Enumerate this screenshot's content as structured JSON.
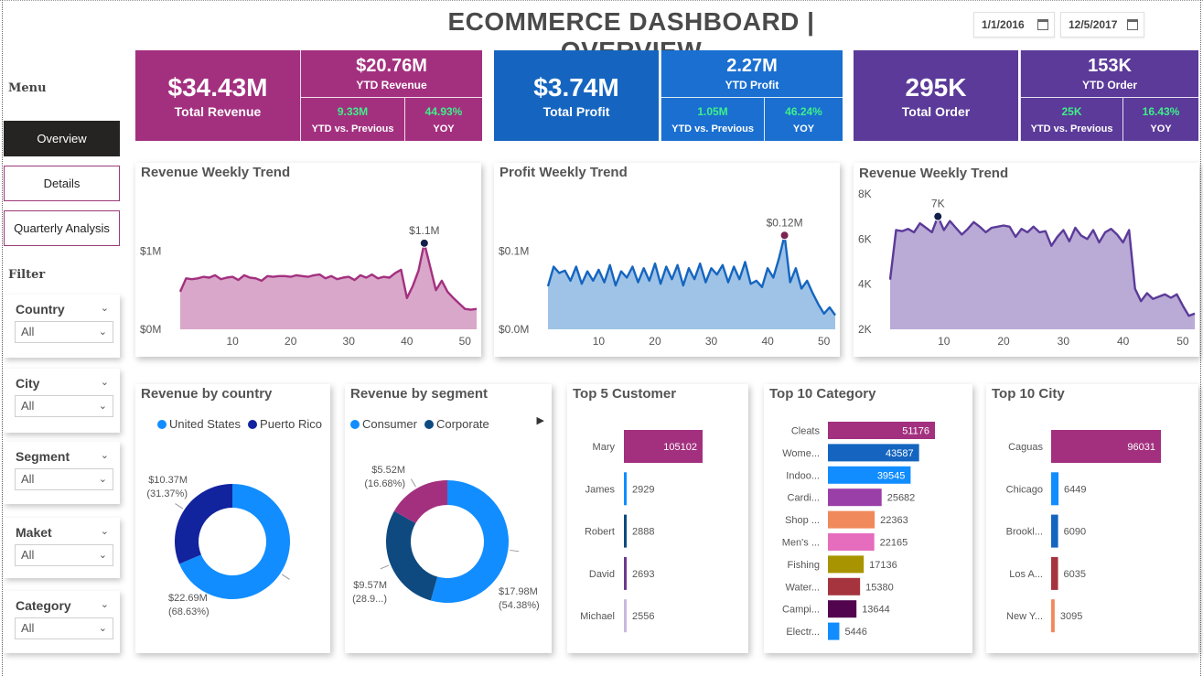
{
  "title": "ECOMMERCE DASHBOARD | OVERVIEW",
  "dates": {
    "start": "1/1/2016",
    "end": "12/5/2017"
  },
  "sidebar": {
    "menu_heading": "Menu",
    "menu_items": [
      "Overview",
      "Details",
      "Quarterly Analysis"
    ],
    "filter_heading": "Filter",
    "filters": [
      {
        "label": "Country",
        "value": "All"
      },
      {
        "label": "City",
        "value": "All"
      },
      {
        "label": "Segment",
        "value": "All"
      },
      {
        "label": "Maket",
        "value": "All"
      },
      {
        "label": "Category",
        "value": "All"
      }
    ]
  },
  "kpis": [
    {
      "value": "$34.43M",
      "label": "Total Revenue",
      "ytd_value": "$20.76M",
      "ytd_label": "YTD Revenue",
      "vs_value": "9.33M",
      "vs_label": "YTD vs. Previous",
      "yoy_value": "44.93%",
      "yoy_label": "YOY",
      "color_main": "#a3307f",
      "color_side": "#a3307f"
    },
    {
      "value": "$3.74M",
      "label": "Total Profit",
      "ytd_value": "2.27M",
      "ytd_label": "YTD Profit",
      "vs_value": "1.05M",
      "vs_label": "YTD vs. Previous",
      "yoy_value": "46.24%",
      "yoy_label": "YOY",
      "color_main": "#1565c0",
      "color_side": "#1a6fd1"
    },
    {
      "value": "295K",
      "label": "Total Order",
      "ytd_value": "153K",
      "ytd_label": "YTD Order",
      "vs_value": "25K",
      "vs_label": "YTD vs. Previous",
      "yoy_value": "16.43%",
      "yoy_label": "YOY",
      "color_main": "#5b3a99",
      "color_side": "#5b3a99"
    }
  ],
  "chart_data": [
    {
      "type": "area",
      "title": "Revenue Weekly Trend",
      "x_ticks": [
        10,
        20,
        30,
        40,
        50
      ],
      "y_ticks": [
        "$0M",
        "$1M"
      ],
      "ylim": [
        0,
        1.6
      ],
      "peak_label": "$1.1M",
      "color": "#a3307f",
      "fill": "#d9a7c9",
      "x": [
        1,
        2,
        3,
        4,
        5,
        6,
        7,
        8,
        9,
        10,
        11,
        12,
        13,
        14,
        15,
        16,
        17,
        18,
        19,
        20,
        21,
        22,
        23,
        24,
        25,
        26,
        27,
        28,
        29,
        30,
        31,
        32,
        33,
        34,
        35,
        36,
        37,
        38,
        39,
        40,
        41,
        42,
        43,
        44,
        45,
        46,
        47,
        48,
        49,
        50,
        51,
        52
      ],
      "values": [
        0.48,
        0.65,
        0.64,
        0.65,
        0.67,
        0.66,
        0.69,
        0.64,
        0.66,
        0.67,
        0.63,
        0.69,
        0.66,
        0.65,
        0.62,
        0.68,
        0.67,
        0.68,
        0.68,
        0.67,
        0.69,
        0.68,
        0.67,
        0.69,
        0.7,
        0.65,
        0.68,
        0.64,
        0.66,
        0.67,
        0.63,
        0.69,
        0.66,
        0.7,
        0.65,
        0.67,
        0.66,
        0.72,
        0.76,
        0.4,
        0.55,
        0.75,
        1.1,
        0.8,
        0.5,
        0.62,
        0.48,
        0.4,
        0.33,
        0.26,
        0.25,
        0.26
      ]
    },
    {
      "type": "area",
      "title": "Profit Weekly Trend",
      "x_ticks": [
        10,
        20,
        30,
        40,
        50
      ],
      "y_ticks": [
        "$0.0M",
        "$0.1M"
      ],
      "ylim": [
        0,
        0.16
      ],
      "peak_label": "$0.12M",
      "color": "#1565c0",
      "fill": "#9fc3e6",
      "x": [
        1,
        2,
        3,
        4,
        5,
        6,
        7,
        8,
        9,
        10,
        11,
        12,
        13,
        14,
        15,
        16,
        17,
        18,
        19,
        20,
        21,
        22,
        23,
        24,
        25,
        26,
        27,
        28,
        29,
        30,
        31,
        32,
        33,
        34,
        35,
        36,
        37,
        38,
        39,
        40,
        41,
        42,
        43,
        44,
        45,
        46,
        47,
        48,
        49,
        50,
        51,
        52
      ],
      "values": [
        0.055,
        0.08,
        0.072,
        0.075,
        0.062,
        0.08,
        0.058,
        0.074,
        0.062,
        0.076,
        0.06,
        0.082,
        0.056,
        0.074,
        0.066,
        0.08,
        0.06,
        0.078,
        0.062,
        0.084,
        0.058,
        0.08,
        0.064,
        0.082,
        0.056,
        0.078,
        0.064,
        0.084,
        0.06,
        0.078,
        0.07,
        0.082,
        0.06,
        0.08,
        0.064,
        0.086,
        0.058,
        0.062,
        0.054,
        0.078,
        0.066,
        0.09,
        0.12,
        0.06,
        0.078,
        0.052,
        0.062,
        0.046,
        0.032,
        0.02,
        0.028,
        0.018
      ]
    },
    {
      "type": "area",
      "title": "Revenue Weekly Trend",
      "x_ticks": [
        10,
        20,
        30,
        40,
        50
      ],
      "y_ticks": [
        "2K",
        "4K",
        "6K",
        "8K"
      ],
      "ylim": [
        2000,
        8000
      ],
      "peak_label": "7K",
      "color": "#5b3a99",
      "fill": "#b9abd5",
      "x": [
        1,
        2,
        3,
        4,
        5,
        6,
        7,
        8,
        9,
        10,
        11,
        12,
        13,
        14,
        15,
        16,
        17,
        18,
        19,
        20,
        21,
        22,
        23,
        24,
        25,
        26,
        27,
        28,
        29,
        30,
        31,
        32,
        33,
        34,
        35,
        36,
        37,
        38,
        39,
        40,
        41,
        42,
        43,
        44,
        45,
        46,
        47,
        48,
        49,
        50,
        51,
        52
      ],
      "values": [
        4200,
        6400,
        6350,
        6450,
        6300,
        6700,
        6500,
        6300,
        7000,
        6400,
        6800,
        6500,
        6200,
        6450,
        6750,
        6550,
        6300,
        6500,
        6550,
        6600,
        6550,
        6100,
        6450,
        6300,
        6550,
        6300,
        6350,
        5700,
        6100,
        6400,
        5900,
        6500,
        6150,
        6000,
        6400,
        5850,
        6300,
        6450,
        6200,
        5850,
        6400,
        3800,
        3250,
        3600,
        3350,
        3450,
        3550,
        3400,
        3550,
        3050,
        2600,
        2700
      ]
    },
    {
      "type": "pie",
      "title": "Revenue by country",
      "series": [
        {
          "name": "United States",
          "value": 22.69,
          "label": "$22.69M",
          "pct": "(68.63%)",
          "color": "#118dff"
        },
        {
          "name": "Puerto Rico",
          "value": 10.37,
          "label": "$10.37M",
          "pct": "(31.37%)",
          "color": "#12239e"
        }
      ]
    },
    {
      "type": "pie",
      "title": "Revenue by segment",
      "series": [
        {
          "name": "Consumer",
          "value": 17.98,
          "label": "$17.98M",
          "pct": "(54.38%)",
          "color": "#118dff"
        },
        {
          "name": "Corporate",
          "value": 9.57,
          "label": "$9.57M",
          "pct": "(28.9...)",
          "color": "#0e4a80"
        },
        {
          "name": "",
          "value": 5.52,
          "label": "$5.52M",
          "pct": "(16.68%)",
          "color": "#a3307f"
        }
      ]
    },
    {
      "type": "bar",
      "title": "Top 5 Customer",
      "categories": [
        "Mary",
        "James",
        "Robert",
        "David",
        "Michael"
      ],
      "values": [
        105102,
        2929,
        2888,
        2693,
        2556
      ],
      "colors": [
        "#a3307f",
        "#118dff",
        "#0e4a80",
        "#6b3a8f",
        "#c9b8e0"
      ]
    },
    {
      "type": "bar",
      "title": "Top 10 Category",
      "categories": [
        "Cleats",
        "Wome...",
        "Indoo...",
        "Cardi...",
        "Shop ...",
        "Men's ...",
        "Fishing",
        "Water...",
        "Campi...",
        "Electr..."
      ],
      "values": [
        51176,
        43587,
        39545,
        25682,
        22363,
        22165,
        17136,
        15380,
        13644,
        5446
      ],
      "colors": [
        "#a3307f",
        "#1565c0",
        "#118dff",
        "#9b3fa8",
        "#f08a5d",
        "#e66cbe",
        "#a89400",
        "#a6343f",
        "#52044f",
        "#118dff"
      ]
    },
    {
      "type": "bar",
      "title": "Top 10 City",
      "categories": [
        "Caguas",
        "Chicago",
        "Brookl...",
        "Los A...",
        "New Y..."
      ],
      "values": [
        96031,
        6449,
        6090,
        6035,
        3095
      ],
      "colors": [
        "#a3307f",
        "#118dff",
        "#1565c0",
        "#a6343f",
        "#f08a5d"
      ]
    }
  ]
}
